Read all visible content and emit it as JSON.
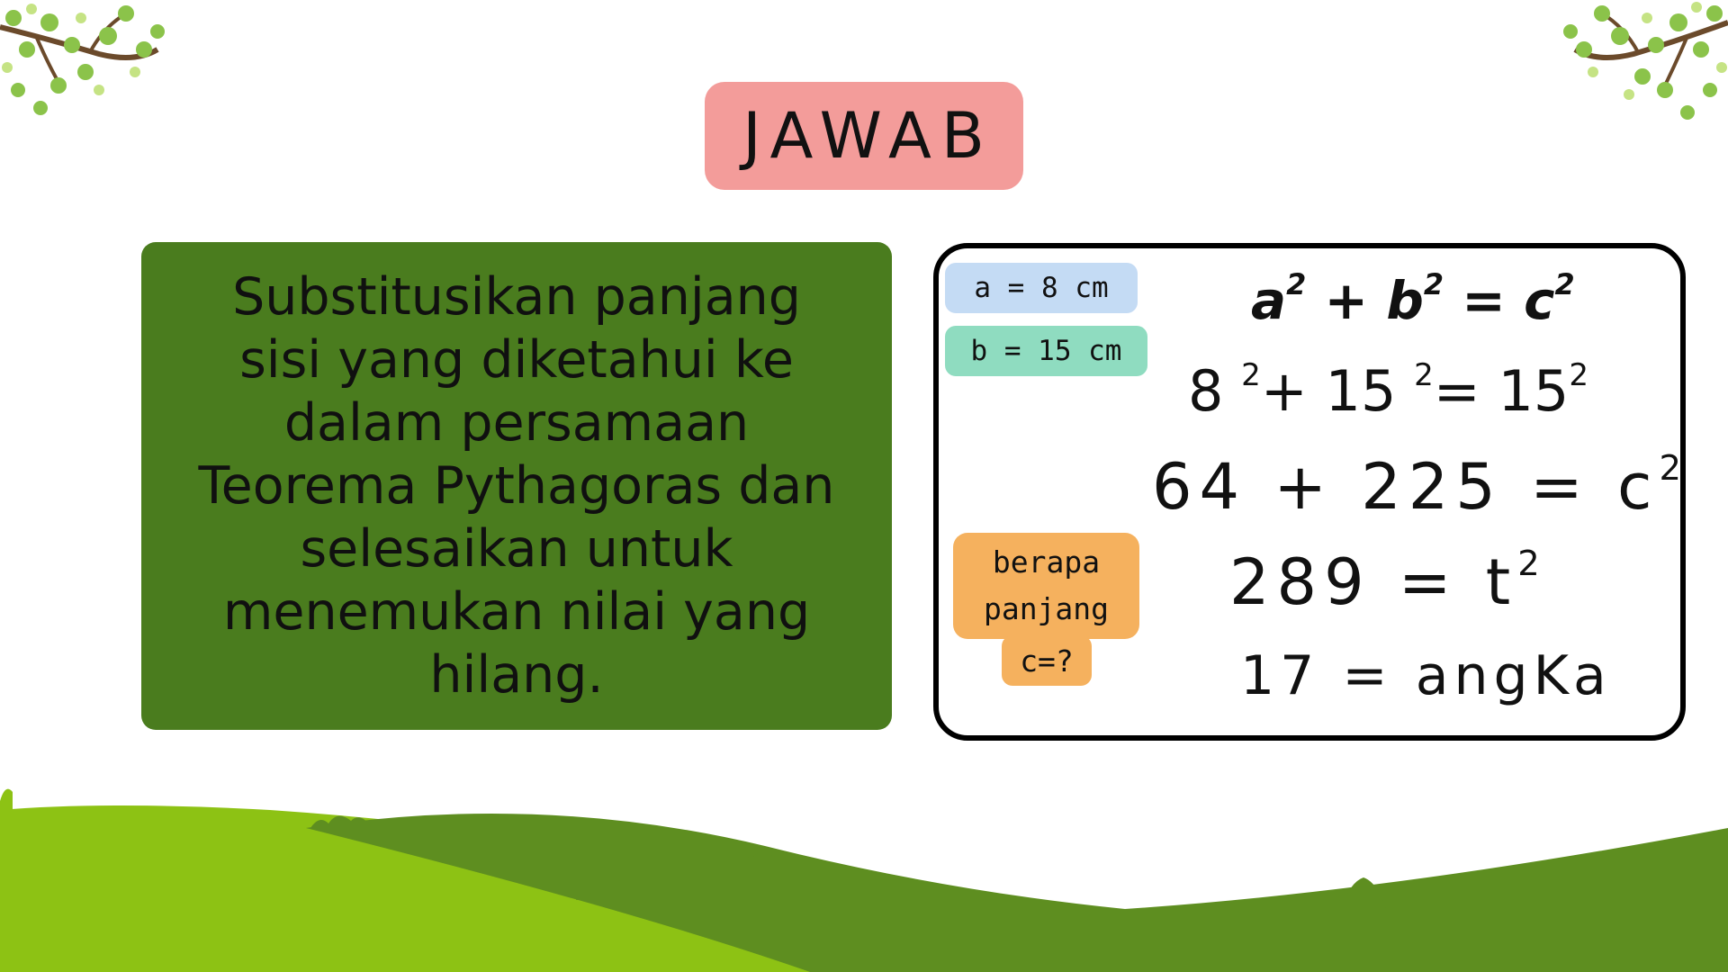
{
  "title": "JAWAB",
  "instruction": "Substitusikan panjang sisi yang diketahui ke dalam persamaan Teorema Pythagoras dan selesaikan untuk menemukan nilai yang hilang.",
  "givens": {
    "a": "a = 8 cm",
    "b": "b = 15 cm"
  },
  "question": {
    "line1": "berapa",
    "line2": "panjang",
    "line3": "c=?"
  },
  "formula": {
    "a": "a",
    "plus": "+",
    "b": "b",
    "eq": "=",
    "c": "c",
    "exp": "2"
  },
  "steps": {
    "line1": {
      "p1": "8 ",
      "s1": "2",
      "p2": "+ 15 ",
      "s2": "2",
      "p3": "= 15",
      "s3": "2"
    },
    "line2": {
      "text": "64 + 225 = c",
      "exp": "2"
    },
    "line3": {
      "text": "289 = t",
      "exp": "2"
    },
    "line4": {
      "text": "17 = angKa"
    }
  },
  "colors": {
    "title_bg": "#f39c9a",
    "card_bg": "#4a7c1e",
    "tag_a": "#c4dbf4",
    "tag_b": "#8fdcc0",
    "tag_question": "#f5b15e",
    "hill_light": "#8dc214",
    "hill_dark": "#5e8e20"
  },
  "decorations": [
    "tree-branch-icon",
    "grass-hill-icon"
  ]
}
